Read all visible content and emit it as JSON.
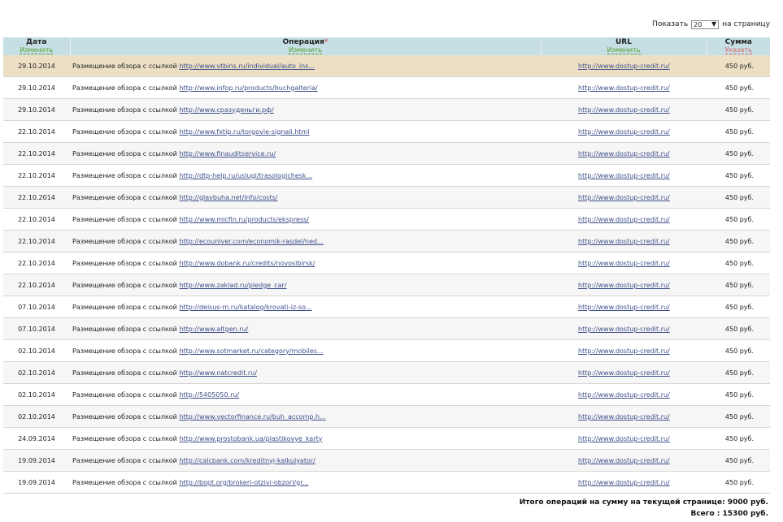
{
  "pagination": {
    "show_label": "Показать",
    "per_page_value": "20",
    "per_page_suffix": "на страницу"
  },
  "table": {
    "headers": {
      "date": "Дата",
      "date_action": "Изменить",
      "operation": "Операция",
      "operation_marker": "*",
      "operation_action": "Изменить",
      "url": "URL",
      "url_action": "Изменить",
      "sum": "Сумма",
      "sum_action": "Указать"
    },
    "rows": [
      {
        "date": "29.10.2014",
        "op": "Размещение обзора с ссылкой",
        "link": "http://www.vtbins.ru/individual/auto_ins...",
        "url": "http://www.dostup-credit.ru/",
        "sum": "450 руб."
      },
      {
        "date": "29.10.2014",
        "op": "Размещение обзора с ссылкой",
        "link": "http://www.infop.ru/products/buchgalteria/",
        "url": "http://www.dostup-credit.ru/",
        "sum": "450 руб."
      },
      {
        "date": "29.10.2014",
        "op": "Размещение обзора с ссылкой",
        "link": "http://www.сразуденьги.рф/",
        "url": "http://www.dostup-credit.ru/",
        "sum": "450 руб."
      },
      {
        "date": "22.10.2014",
        "op": "Размещение обзора с ссылкой",
        "link": "http://www.fxtip.ru/torgovie-signali.html",
        "url": "http://www.dostup-credit.ru/",
        "sum": "450 руб."
      },
      {
        "date": "22.10.2014",
        "op": "Размещение обзора с ссылкой",
        "link": "http://www.finauditservice.ru/",
        "url": "http://www.dostup-credit.ru/",
        "sum": "450 руб."
      },
      {
        "date": "22.10.2014",
        "op": "Размещение обзора с ссылкой",
        "link": "http://dtp-help.ru/uslugi/trasologichesk...",
        "url": "http://www.dostup-credit.ru/",
        "sum": "450 руб."
      },
      {
        "date": "22.10.2014",
        "op": "Размещение обзора с ссылкой",
        "link": "http://glavbuha.net/info/costs/",
        "url": "http://www.dostup-credit.ru/",
        "sum": "450 руб."
      },
      {
        "date": "22.10.2014",
        "op": "Размещение обзора с ссылкой",
        "link": "http://www.micfin.ru/products/ekspress/",
        "url": "http://www.dostup-credit.ru/",
        "sum": "450 руб."
      },
      {
        "date": "22.10.2014",
        "op": "Размещение обзора с ссылкой",
        "link": "http://ecouniver.com/economik-rasdel/ned...",
        "url": "http://www.dostup-credit.ru/",
        "sum": "450 руб."
      },
      {
        "date": "22.10.2014",
        "op": "Размещение обзора с ссылкой",
        "link": "http://www.dobank.ru/credits/novosibirsk/",
        "url": "http://www.dostup-credit.ru/",
        "sum": "450 руб."
      },
      {
        "date": "22.10.2014",
        "op": "Размещение обзора с ссылкой",
        "link": "http://www.zaklad.ru/pledge_car/",
        "url": "http://www.dostup-credit.ru/",
        "sum": "450 руб."
      },
      {
        "date": "07.10.2014",
        "op": "Размещение обзора с ссылкой",
        "link": "http://deisus-m.ru/katalog/krovati-iz-so...",
        "url": "http://www.dostup-credit.ru/",
        "sum": "450 руб."
      },
      {
        "date": "07.10.2014",
        "op": "Размещение обзора с ссылкой",
        "link": "http://www.altgen.ru/",
        "url": "http://www.dostup-credit.ru/",
        "sum": "450 руб."
      },
      {
        "date": "02.10.2014",
        "op": "Размещение обзора с ссылкой",
        "link": "http://www.sotmarket.ru/category/mobiles...",
        "url": "http://www.dostup-credit.ru/",
        "sum": "450 руб."
      },
      {
        "date": "02.10.2014",
        "op": "Размещение обзора с ссылкой",
        "link": "http://www.natcredit.ru/",
        "url": "http://www.dostup-credit.ru/",
        "sum": "450 руб."
      },
      {
        "date": "02.10.2014",
        "op": "Размещение обзора с ссылкой",
        "link": "http://5405050.ru/",
        "url": "http://www.dostup-credit.ru/",
        "sum": "450 руб."
      },
      {
        "date": "02.10.2014",
        "op": "Размещение обзора с ссылкой",
        "link": "http://www.vectorfinance.ru/buh_accomp.h...",
        "url": "http://www.dostup-credit.ru/",
        "sum": "450 руб."
      },
      {
        "date": "24.09.2014",
        "op": "Размещение обзора с ссылкой",
        "link": "http://www.prostobank.ua/plastikovye_karty",
        "url": "http://www.dostup-credit.ru/",
        "sum": "450 руб."
      },
      {
        "date": "19.09.2014",
        "op": "Размещение обзора с ссылкой",
        "link": "http://calcbank.com/kreditnyj-kalkulyator/",
        "url": "http://www.dostup-credit.ru/",
        "sum": "450 руб."
      },
      {
        "date": "19.09.2014",
        "op": "Размещение обзора с ссылкой",
        "link": "http://bopt.org/brokeri-otzivi-obzori/gr...",
        "url": "http://www.dostup-credit.ru/",
        "sum": "450 руб."
      }
    ]
  },
  "totals": {
    "page_total": "Итого операций на сумму на текущей странице: 9000 руб.",
    "grand_total": "Всего : 15300 руб."
  },
  "colors": {
    "header_bg": "#c5dfe5",
    "highlight_row": "#ecdfc4",
    "action_green": "#5aa02c",
    "action_red": "#e06060",
    "link": "#3f4f8a"
  },
  "icons": {
    "per_page_dropdown": "triangle-down-icon"
  }
}
